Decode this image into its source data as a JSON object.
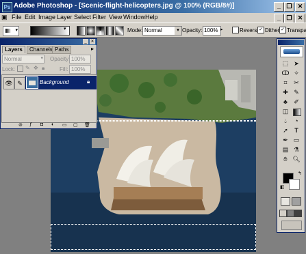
{
  "window": {
    "app_icon": "Ps",
    "title": "Adobe Photoshop - [Scenic-flight-helicopters.jpg @ 100% (RGB/8#)]",
    "minimize_glyph": "_",
    "restore_glyph": "❐",
    "close_glyph": "✕",
    "doc_minimize_glyph": "_",
    "doc_restore_glyph": "❐",
    "doc_close_glyph": "✕"
  },
  "menu": [
    "File",
    "Edit",
    "Image",
    "Layer",
    "Select",
    "Filter",
    "View",
    "Window",
    "Help"
  ],
  "options_bar": {
    "mode_label": "Mode:",
    "mode_value": "Normal",
    "opacity_label": "Opacity:",
    "opacity_value": "100%",
    "reverse_label": "Reverse",
    "reverse_checked": false,
    "dither_label": "Dither",
    "dither_checked": true,
    "transparency_label": "Transpar",
    "transparency_checked": true
  },
  "layers_palette": {
    "tabs": [
      "Layers",
      "Channels",
      "Paths"
    ],
    "active_tab": "Layers",
    "blend_mode": "Normal",
    "opacity_label": "Opacity:",
    "opacity_value": "100%",
    "lock_label": "Lock:",
    "fill_label": "Fill:",
    "fill_value": "100%",
    "layers": [
      {
        "name": "Background",
        "visible": true,
        "selected": true,
        "locked": true
      }
    ]
  },
  "colors": {
    "title_bar": "#0a246a",
    "chrome": "#d4d0c8",
    "workspace": "#808080",
    "selection": "#0a246a"
  },
  "icons": {
    "eye": "eye-icon",
    "brush": "brush-icon",
    "lock": "lock-icon"
  }
}
